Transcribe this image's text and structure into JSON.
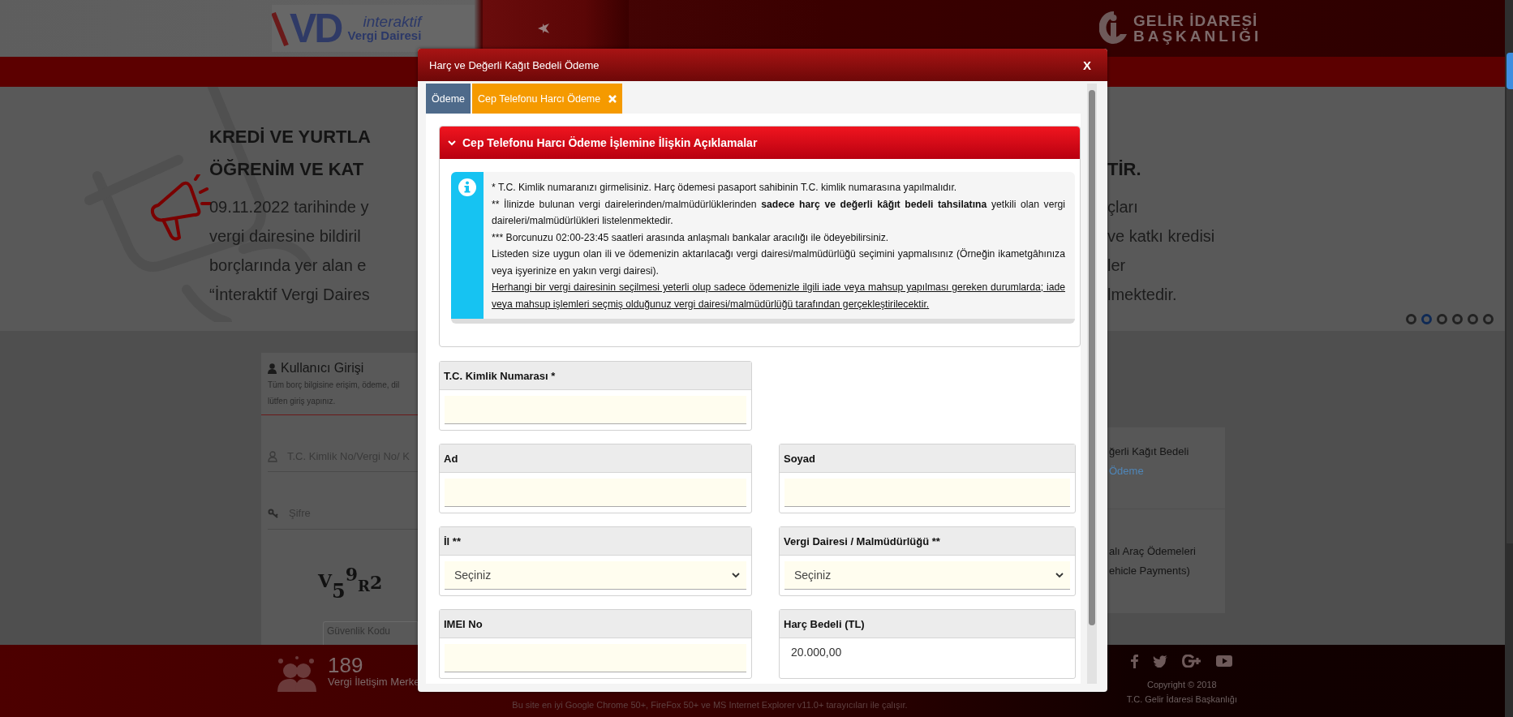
{
  "header": {
    "logo_mark": "VD",
    "logo_line_1": "interaktif",
    "logo_line_2": "Vergi Dairesi",
    "agency_line_1": "GELİR İDARESİ",
    "agency_line_2": "BAŞKANLIĞI"
  },
  "slider": {
    "rows": [
      {
        "kind": "title",
        "left": "KREDİ VE YURTLA"
      },
      {
        "kind": "title",
        "left": "ÖĞRENİM VE KAT",
        "right": "TİR."
      },
      {
        "kind": "body",
        "left": "09.11.2022 tarihinde y",
        "right": "çları"
      },
      {
        "kind": "body",
        "left": "vergi dairesine bildiril",
        "right": "ve katkı kredisi"
      },
      {
        "kind": "body",
        "left": "borçlarında yer alan e",
        "right": "ler"
      },
      {
        "kind": "body",
        "left": "“İnteraktif Vergi Daires",
        "right": "lmektedir."
      }
    ],
    "dots": [
      {
        "selected": false
      },
      {
        "selected": true
      },
      {
        "selected": false
      },
      {
        "selected": false
      },
      {
        "selected": false
      },
      {
        "selected": false
      }
    ]
  },
  "login": {
    "title": "Kullanıcı Girişi",
    "subtitle_lines": [
      "Tüm borç bilgisine erişim, ödeme, dil",
      "lütfen giriş yapınız."
    ],
    "id_placeholder": "T.C. Kimlik No/Vergi No/ K",
    "password_placeholder": "Şifre",
    "captcha": "V59R2",
    "security_placeholder": "Güvenlik Kodu"
  },
  "side_cards": [
    {
      "lines": [
        "ğerli Kağıt Bedeli"
      ],
      "link": "Ödeme"
    },
    {
      "lines": [
        "alı Araç Ödemeleri",
        "ehicle Payments)"
      ]
    }
  ],
  "footer": {
    "phone": "189",
    "phone_label": "Vergi İletişim Merke",
    "copyright": "Copyright © 2018",
    "agency": "T.C. Gelir İdaresi Başkanlığı",
    "browser_note": "Bu site en iyi Google Chrome 50+, FireFox 50+ ve MS Internet Explorer v11.0+ tarayıcıları ile çalışır."
  },
  "modal": {
    "title": "Harç ve Değerli Kağıt Bedeli Ödeme",
    "close": "X",
    "tabs": [
      {
        "label": "Ödeme",
        "selected": false,
        "closable": false
      },
      {
        "label": "Cep Telefonu Harcı Ödeme",
        "selected": true,
        "closable": true
      }
    ],
    "panel": {
      "title": "Cep Telefonu Harcı Ödeme İşlemine İlişkin Açıklamalar",
      "expanded": true,
      "notes": [
        {
          "kind": "plain",
          "parts": [
            {
              "text": "* T.C. Kimlik numaranızı girmelisiniz. Harç ödemesi pasaport sahibinin T.C. kimlik numarasına yapılmalıdır.",
              "bold": false
            }
          ]
        },
        {
          "kind": "plain",
          "parts": [
            {
              "text": "** İlinizde bulunan vergi dairelerinden/malmüdürlüklerinden ",
              "bold": false
            },
            {
              "text": "sadece harç ve değerli kâğıt bedeli tahsilatına",
              "bold": true
            },
            {
              "text": " yetkili olan vergi daireleri/malmüdürlükleri listelenmektedir.",
              "bold": false
            }
          ]
        },
        {
          "kind": "plain",
          "parts": [
            {
              "text": "*** Borcunuzu 02:00-23:45 saatleri arasında anlaşmalı bankalar aracılığı ile ödeyebilirsiniz.",
              "bold": false
            }
          ]
        },
        {
          "kind": "plain",
          "parts": [
            {
              "text": "Listeden size uygun olan ili ve ödemenizin aktarılacağı vergi dairesi/malmüdürlüğü seçimini yapmalısınız (Örneğin ikametgâhınıza veya işyerinize en yakın vergi dairesi).",
              "bold": false
            }
          ]
        },
        {
          "kind": "underlined",
          "parts": [
            {
              "text": "Herhangi bir vergi dairesinin seçilmesi yeterli olup sadece ödemenizle ilgili iade veya mahsup yapılması gereken durumlarda; iade veya mahsup işlemleri seçmiş olduğunuz vergi dairesi/malmüdürlüğü tarafından gerçekleştirilecektir.",
              "bold": false
            }
          ]
        }
      ]
    },
    "form_rows": [
      [
        {
          "label": "T.C. Kimlik Numarası *",
          "kind": "text"
        }
      ],
      [
        {
          "label": "Ad",
          "kind": "text"
        },
        {
          "label": "Soyad",
          "kind": "text"
        }
      ],
      [
        {
          "label": "İl **",
          "kind": "select",
          "value": "Seçiniz"
        },
        {
          "label": "Vergi Dairesi / Malmüdürlüğü **",
          "kind": "select",
          "value": "Seçiniz"
        }
      ],
      [
        {
          "label": "IMEI No",
          "kind": "text"
        },
        {
          "label": "Harç Bedeli (TL)",
          "kind": "readonly",
          "value": "20.000,00"
        }
      ]
    ]
  }
}
